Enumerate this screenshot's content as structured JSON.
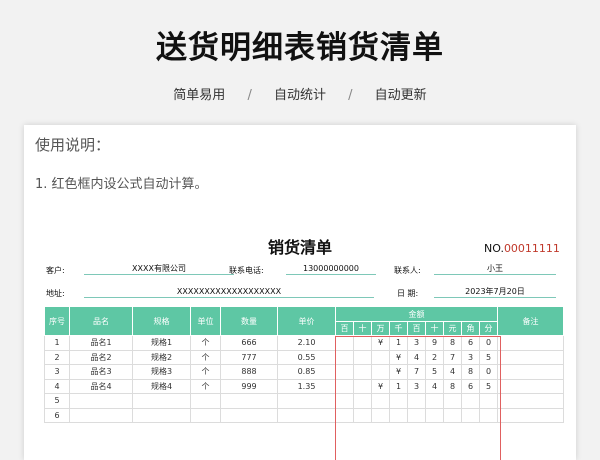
{
  "header": {
    "title": "送货明细表销货清单",
    "tags": [
      "简单易用",
      "自动统计",
      "自动更新"
    ]
  },
  "usage": {
    "title": "使用说明：",
    "line1": "1. 红色框内设公式自动计算。"
  },
  "sheet": {
    "title": "销货清单",
    "no_label": "NO.",
    "no_value": "00011111",
    "customer_label": "客户:",
    "customer_value": "XXXX有限公司",
    "phone_label": "联系电话:",
    "phone_value": "13000000000",
    "contact_label": "联系人:",
    "contact_value": "小王",
    "address_label": "地址:",
    "address_value": "XXXXXXXXXXXXXXXXXXX",
    "date_label": "日  期:",
    "date_value": "2023年7月20日"
  },
  "table": {
    "headers": {
      "seq": "序号",
      "name": "品名",
      "spec": "规格",
      "unit": "单位",
      "qty": "数量",
      "price": "单价",
      "amount": "金额",
      "remark": "备注"
    },
    "digits": [
      "百",
      "十",
      "万",
      "千",
      "百",
      "十",
      "元",
      "角",
      "分"
    ],
    "rows": [
      {
        "seq": "1",
        "name": "品名1",
        "spec": "规格1",
        "unit": "个",
        "qty": "666",
        "price": "2.10",
        "d": [
          "",
          "",
          "¥",
          "1",
          "3",
          "9",
          "8",
          "6",
          "0"
        ]
      },
      {
        "seq": "2",
        "name": "品名2",
        "spec": "规格2",
        "unit": "个",
        "qty": "777",
        "price": "0.55",
        "d": [
          "",
          "",
          "",
          "¥",
          "4",
          "2",
          "7",
          "3",
          "5"
        ]
      },
      {
        "seq": "3",
        "name": "品名3",
        "spec": "规格3",
        "unit": "个",
        "qty": "888",
        "price": "0.85",
        "d": [
          "",
          "",
          "",
          "¥",
          "7",
          "5",
          "4",
          "8",
          "0"
        ]
      },
      {
        "seq": "4",
        "name": "品名4",
        "spec": "规格4",
        "unit": "个",
        "qty": "999",
        "price": "1.35",
        "d": [
          "",
          "",
          "¥",
          "1",
          "3",
          "4",
          "8",
          "6",
          "5"
        ]
      },
      {
        "seq": "5",
        "name": "",
        "spec": "",
        "unit": "",
        "qty": "",
        "price": "",
        "d": [
          "",
          "",
          "",
          "",
          "",
          "",
          "",
          "",
          ""
        ]
      },
      {
        "seq": "6",
        "name": "",
        "spec": "",
        "unit": "",
        "qty": "",
        "price": "",
        "d": [
          "",
          "",
          "",
          "",
          "",
          "",
          "",
          "",
          ""
        ]
      }
    ]
  }
}
